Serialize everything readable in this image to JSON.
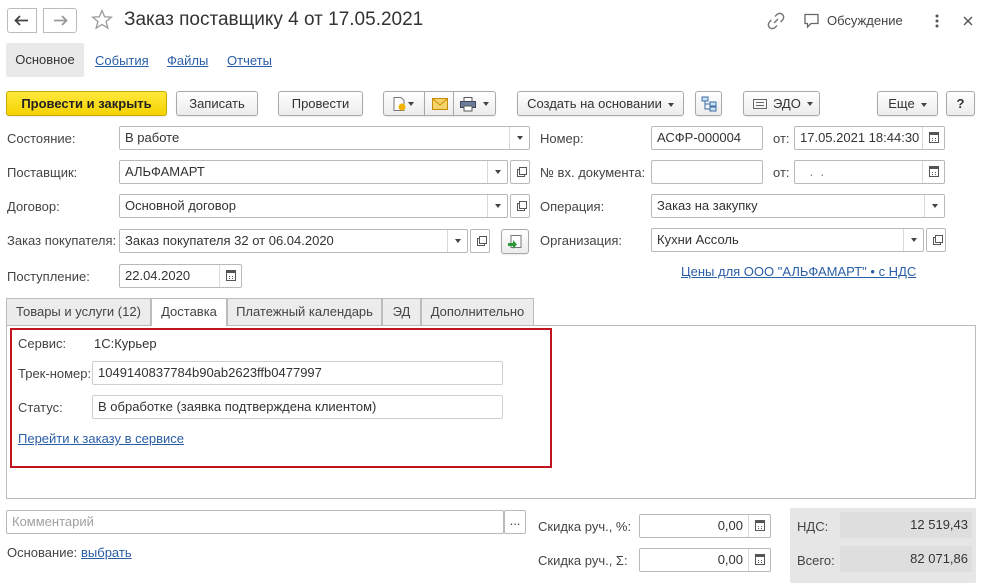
{
  "header": {
    "title": "Заказ поставщику 4 от 17.05.2021",
    "discussion_label": "Обсуждение"
  },
  "nav": {
    "tabs": [
      "Основное",
      "События",
      "Файлы",
      "Отчеты"
    ]
  },
  "toolbar": {
    "post_close_label": "Провести и закрыть",
    "save_label": "Записать",
    "post_label": "Провести",
    "create_based_label": "Создать на основании",
    "edo_label": "ЭДО",
    "more_label": "Еще",
    "help_label": "?"
  },
  "form": {
    "state_label": "Состояние:",
    "state_value": "В работе",
    "supplier_label": "Поставщик:",
    "supplier_value": "АЛЬФАМАРТ",
    "contract_label": "Договор:",
    "contract_value": "Основной договор",
    "customer_order_label": "Заказ покупателя:",
    "customer_order_value": "Заказ покупателя 32 от 06.04.2020",
    "receipt_label": "Поступление:",
    "receipt_value": "22.04.2020",
    "number_label": "Номер:",
    "number_value": "АСФР-000004",
    "date_from_label": "от:",
    "date_value": "17.05.2021 18:44:30",
    "incoming_doc_label": "№ вх. документа:",
    "incoming_doc_value": "",
    "incoming_date_label": "от:",
    "incoming_date_value": " .  .",
    "operation_label": "Операция:",
    "operation_value": "Заказ на закупку",
    "organization_label": "Организация:",
    "organization_value": "Кухни Ассоль",
    "prices_link": "Цены для ООО \"АЛЬФАМАРТ\" • с НДС"
  },
  "tabs": [
    {
      "label": "Товары и услуги (12)"
    },
    {
      "label": "Доставка"
    },
    {
      "label": "Платежный календарь"
    },
    {
      "label": "ЭД"
    },
    {
      "label": "Дополнительно"
    }
  ],
  "delivery": {
    "service_label": "Сервис:",
    "service_value": "1С:Курьер",
    "track_label": "Трек-номер:",
    "track_value": "1049140837784b90ab2623ffb0477997",
    "status_label": "Статус:",
    "status_value": "В обработке (заявка подтверждена клиентом)",
    "order_link": "Перейти к заказу в сервисе"
  },
  "footer": {
    "comment_placeholder": "Комментарий",
    "comment_btn": "...",
    "basis_label": "Основание:",
    "basis_link": "выбрать",
    "discount_pct_label": "Скидка руч., %:",
    "discount_pct_value": "0,00",
    "discount_sum_label": "Скидка руч., Σ:",
    "discount_sum_value": "0,00",
    "vat_label": "НДС:",
    "vat_value": "12 519,43",
    "total_label": "Всего:",
    "total_value": "82 071,86"
  },
  "colors": {
    "accent_yellow": "#f5d200",
    "link_blue": "#2a5ea7",
    "highlight_red": "#c0141f"
  }
}
